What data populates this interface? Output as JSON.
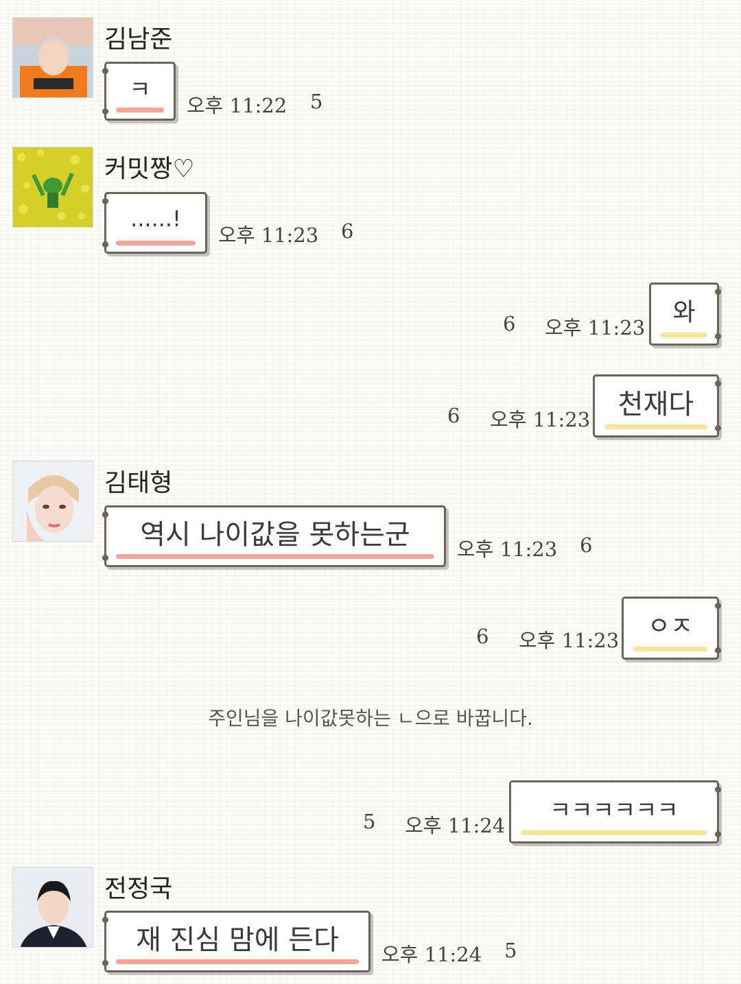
{
  "messages": [
    {
      "sender": "김남준",
      "text": "ㅋ",
      "time": "오후 11:22",
      "unread": "5"
    },
    {
      "sender": "커밋짱♡",
      "text": "......!",
      "time": "오후 11:23",
      "unread": "6"
    },
    {
      "text": "와",
      "time": "오후 11:23",
      "unread": "6"
    },
    {
      "text": "천재다",
      "time": "오후 11:23",
      "unread": "6"
    },
    {
      "sender": "김태형",
      "text": "역시 나이값을 못하는군",
      "time": "오후 11:23",
      "unread": "6"
    },
    {
      "text": "ㅇㅈ",
      "time": "오후 11:23",
      "unread": "6"
    },
    {
      "text": "ㅋㅋㅋㅋㅋㅋ",
      "time": "오후 11:24",
      "unread": "5"
    },
    {
      "sender": "전정국",
      "text": "재 진심 맘에 든다",
      "time": "오후 11:24",
      "unread": "5"
    }
  ],
  "system_notice": "주인님을 나이값못하는 ㄴ으로 바꿉니다.",
  "colors": {
    "incoming_underline": "#f2a69a",
    "outgoing_underline": "#f6e59c",
    "bubble_border": "#6b6258"
  }
}
